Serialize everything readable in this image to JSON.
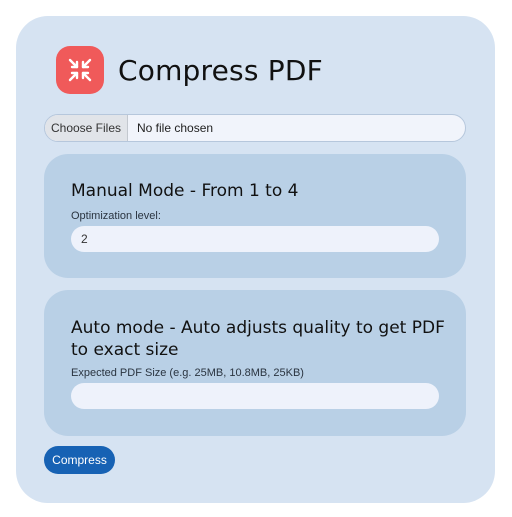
{
  "app": {
    "title": "Compress PDF",
    "icon": "compress-arrows-icon",
    "icon_bg": "#f05a5a"
  },
  "file_input": {
    "button_label": "Choose Files",
    "status": "No file chosen"
  },
  "manual_mode": {
    "title": "Manual Mode - From 1 to 4",
    "label": "Optimization level:",
    "value": "2"
  },
  "auto_mode": {
    "title": "Auto mode - Auto adjusts quality to get PDF to exact size",
    "label": "Expected PDF Size (e.g. 25MB, 10.8MB, 25KB)",
    "value": ""
  },
  "actions": {
    "compress_label": "Compress",
    "accent": "#1762b4"
  }
}
